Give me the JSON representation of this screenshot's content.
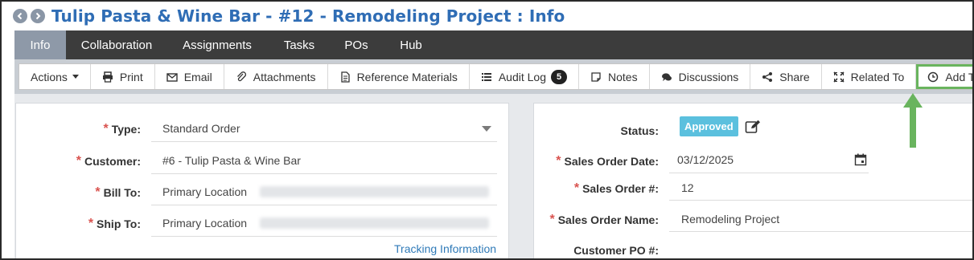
{
  "header": {
    "title": "Tulip Pasta & Wine Bar - #12 - Remodeling Project : Info"
  },
  "tabs": [
    {
      "label": "Info",
      "active": true
    },
    {
      "label": "Collaboration"
    },
    {
      "label": "Assignments"
    },
    {
      "label": "Tasks"
    },
    {
      "label": "POs"
    },
    {
      "label": "Hub"
    }
  ],
  "toolbar": {
    "actions": "Actions",
    "print": "Print",
    "email": "Email",
    "attachments": "Attachments",
    "reference_materials": "Reference Materials",
    "audit_log": "Audit Log",
    "audit_log_count": "5",
    "notes": "Notes",
    "discussions": "Discussions",
    "share": "Share",
    "related_to": "Related To",
    "add_time": "Add Time"
  },
  "left_form": {
    "type_label": "Type:",
    "type_value": "Standard Order",
    "customer_label": "Customer:",
    "customer_value": "#6 - Tulip Pasta & Wine Bar",
    "bill_to_label": "Bill To:",
    "bill_to_value": "Primary Location",
    "ship_to_label": "Ship To:",
    "ship_to_value": "Primary Location",
    "tracking_link": "Tracking Information"
  },
  "right_form": {
    "status_label": "Status:",
    "status_value": "Approved",
    "sales_order_date_label": "Sales Order Date:",
    "sales_order_date_value": "03/12/2025",
    "sales_order_num_label": "Sales Order #:",
    "sales_order_num_value": "12",
    "sales_order_name_label": "Sales Order Name:",
    "sales_order_name_value": "Remodeling Project",
    "customer_po_label": "Customer PO #:"
  },
  "colors": {
    "title": "#2f6db5",
    "tabs_bg": "#3c3c3c",
    "active_tab": "#8e99a8",
    "required": "#d9534f",
    "status_badge": "#5bc0de",
    "highlight": "#69b45e",
    "link": "#2f7ab8"
  },
  "icons": {
    "back": "arrow-left-circle-icon",
    "forward": "arrow-right-circle-icon",
    "print": "printer-icon",
    "email": "envelope-icon",
    "attachments": "paperclip-icon",
    "reference_materials": "document-icon",
    "audit_log": "list-icon",
    "notes": "note-icon",
    "discussions": "chat-icon",
    "share": "share-icon",
    "related_to": "expand-icon",
    "add_time": "clock-icon",
    "edit": "edit-icon",
    "calendar": "calendar-icon"
  }
}
